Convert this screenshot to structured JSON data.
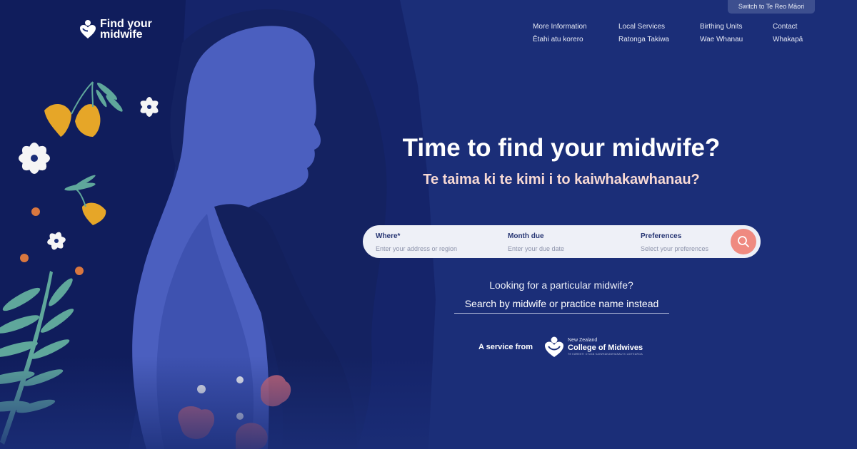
{
  "topbar": {
    "language_toggle": "Switch to Te Reo Māori"
  },
  "logo": {
    "line1": "Find your",
    "line2": "midwife",
    "icon": "heart-person-icon"
  },
  "nav": [
    {
      "en": "More Information",
      "mi": "Ētahi atu korero"
    },
    {
      "en": "Local Services",
      "mi": "Ratonga Takiwa"
    },
    {
      "en": "Birthing Units",
      "mi": "Wae Whanau"
    },
    {
      "en": "Contact",
      "mi": "Whakapā"
    }
  ],
  "hero": {
    "title": "Time to find your midwife?",
    "subtitle": "Te taima ki te kimi i to kaiwhakawhanau?"
  },
  "search": {
    "where": {
      "label": "Where*",
      "placeholder": "Enter your address or region"
    },
    "month": {
      "label": "Month due",
      "placeholder": "Enter your due date"
    },
    "preferences": {
      "label": "Preferences",
      "placeholder": "Select your preferences"
    },
    "button_icon": "search-icon"
  },
  "alt_search": {
    "question": "Looking for a particular midwife?",
    "link": "Search by midwife or practice name instead"
  },
  "service": {
    "label": "A service from",
    "org_small": "New Zealand",
    "org_name": "College of Midwives",
    "org_tagline": "TE KĀREETI O NGĀ KAIWHAKAWHANAU KI AOTEAROA"
  },
  "colors": {
    "background": "#1b2e78",
    "accent": "#ef8a80",
    "subtitle": "#f7d9d4",
    "search_bar": "#eef0f7"
  }
}
